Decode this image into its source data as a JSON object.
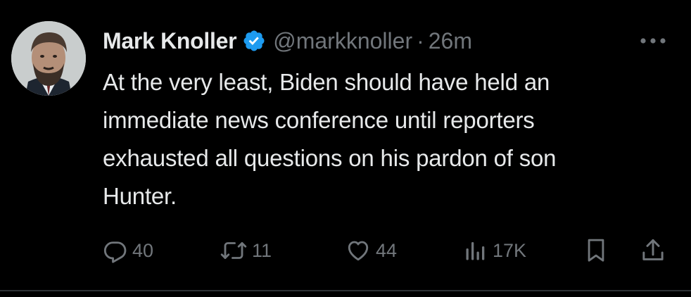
{
  "author": {
    "display_name": "Mark Knoller",
    "handle": "@markknoller",
    "separator": "·",
    "timestamp": "26m",
    "verified": true
  },
  "tweet": {
    "text_lines": [
      "At the very least, Biden should have held an",
      "immediate news conference until reporters",
      "exhausted all questions on his pardon of son",
      "Hunter."
    ]
  },
  "actions": {
    "reply_count": "40",
    "retweet_count": "11",
    "like_count": "44",
    "views_count": "17K"
  },
  "colors": {
    "background": "#000000",
    "primary_text": "#e7e9ea",
    "secondary_text": "#71767b",
    "verified_badge": "#1d9bf0",
    "divider": "#2f3336"
  },
  "icons": {
    "more": "more-horizontal-icon",
    "reply": "reply-icon",
    "retweet": "retweet-icon",
    "like": "heart-icon",
    "views": "views-icon",
    "bookmark": "bookmark-icon",
    "share": "share-icon",
    "verified": "verified-badge-icon"
  }
}
